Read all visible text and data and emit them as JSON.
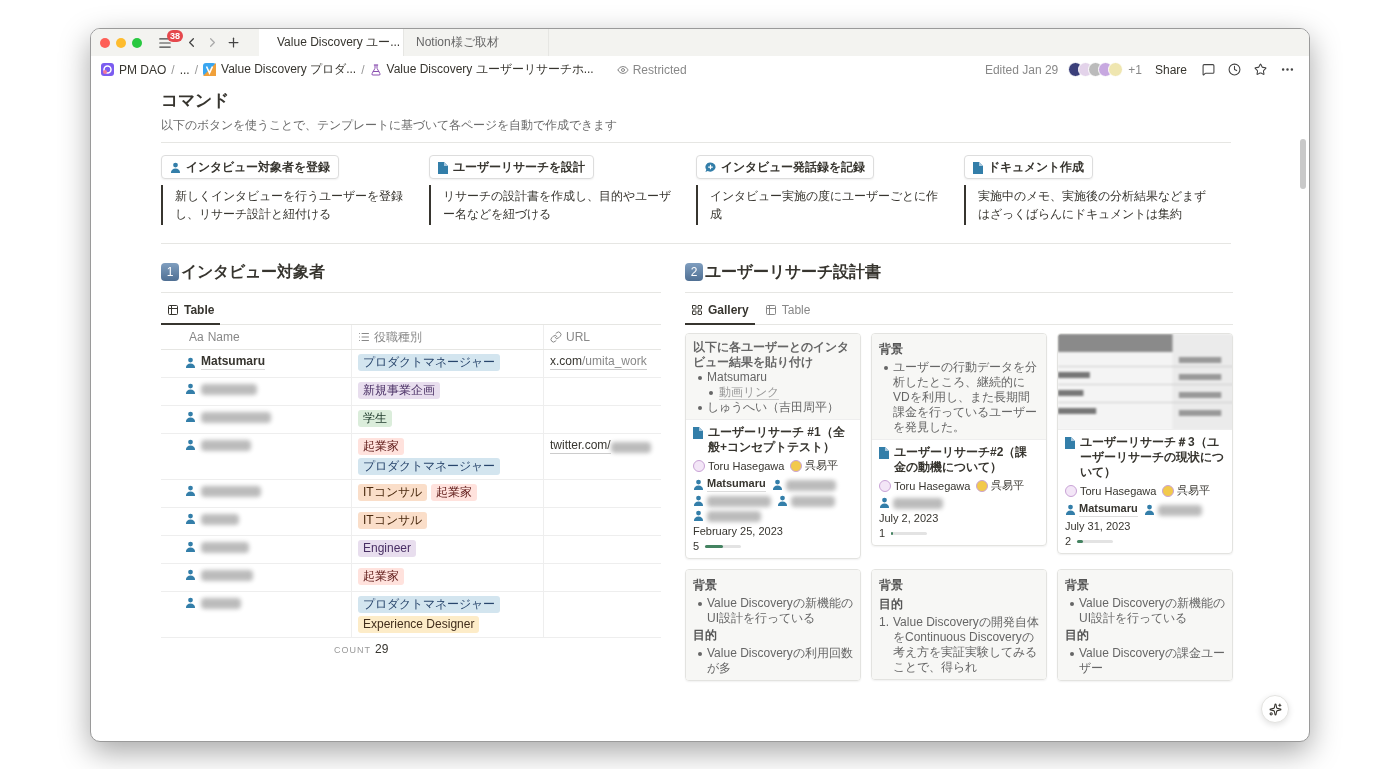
{
  "window": {
    "badge": "38",
    "tabs": [
      {
        "label": "Value Discovery ユー...",
        "selected": true
      },
      {
        "label": "Notion様ご取材",
        "selected": false
      }
    ]
  },
  "breadcrumb": [
    {
      "kind": "page",
      "label": "PM DAO"
    },
    {
      "kind": "separator",
      "label": "/"
    },
    {
      "kind": "page",
      "label": "..."
    },
    {
      "kind": "separator",
      "label": "/"
    },
    {
      "kind": "page",
      "label": "Value Discovery プロダ..."
    },
    {
      "kind": "separator",
      "label": "/"
    },
    {
      "kind": "page",
      "label": "Value Discovery ユーザーリサーチホ..."
    }
  ],
  "access": "Restricted",
  "edited": "Edited Jan 29",
  "more_avatars": "+1",
  "share": "Share",
  "commands": {
    "title": "コマンド",
    "subtitle": "以下のボタンを使うことで、テンプレートに基づいて各ページを自動で作成できます",
    "items": [
      {
        "label": "インタビュー対象者を登録",
        "description": "新しくインタビューを行うユーザーを登録し、リサーチ設計と紐付ける"
      },
      {
        "label": "ユーザーリサーチを設計",
        "description": "リサーチの設計書を作成し、目的やユーザー名などを紐づける"
      },
      {
        "label": "インタビュー発話録を記録",
        "description": "インタビュー実施の度にユーザーごとに作成"
      },
      {
        "label": "ドキュメント作成",
        "description": "実施中のメモ、実施後の分析結果などまずはざっくばらんにドキュメントは集約"
      }
    ]
  },
  "interviewees": {
    "number": "1",
    "title": "インタビュー対象者",
    "views": [
      {
        "label": "Table",
        "selected": true
      }
    ],
    "columns": [
      {
        "label": "Name",
        "prefix": "Aa"
      },
      {
        "label": "役職種別"
      },
      {
        "label": "URL"
      }
    ],
    "rows": [
      {
        "name": "Matsumaru",
        "tags": [
          {
            "label": "プロダクトマネージャー",
            "color": "#d3e5ef"
          }
        ],
        "url": {
          "host": "x.com",
          "path": "/umita_work"
        }
      },
      {
        "redacted": true,
        "tags": [
          {
            "label": "新規事業企画",
            "color": "#e8deee"
          }
        ]
      },
      {
        "redacted": true,
        "tags": [
          {
            "label": "学生",
            "color": "#dbeddb"
          }
        ]
      },
      {
        "redacted": true,
        "tags": [
          {
            "label": "起業家",
            "color": "#ffe2dd"
          },
          {
            "label": "プロダクトマネージャー",
            "color": "#d3e5ef"
          }
        ],
        "url": {
          "host": "twitter.com/",
          "redacted": true
        }
      },
      {
        "redacted": true,
        "tags": [
          {
            "label": "ITコンサル",
            "color": "#fadec9"
          },
          {
            "label": "起業家",
            "color": "#ffe2dd"
          }
        ]
      },
      {
        "redacted": true,
        "tags": [
          {
            "label": "ITコンサル",
            "color": "#fadec9"
          }
        ]
      },
      {
        "redacted": true,
        "tags": [
          {
            "label": "Engineer",
            "color": "#e8deee"
          }
        ]
      },
      {
        "redacted": true,
        "tags": [
          {
            "label": "起業家",
            "color": "#ffe2dd"
          }
        ]
      },
      {
        "redacted": true,
        "tags": [
          {
            "label": "プロダクトマネージャー",
            "color": "#d3e5ef"
          },
          {
            "label": "Experience Designer",
            "color": "#fdecc8"
          }
        ]
      }
    ],
    "count": {
      "label": "COUNT",
      "value": "29"
    }
  },
  "research": {
    "number": "2",
    "title": "ユーザーリサーチ設計書",
    "views": [
      {
        "label": "Gallery",
        "selected": true
      },
      {
        "label": "Table",
        "selected": false
      }
    ],
    "cards": [
      {
        "cover": {
          "kind": "notes",
          "blocks": [
            {
              "kind": "lead",
              "text": "以下に各ユーザーとのインタビュー結果を貼り付け"
            },
            {
              "kind": "bullet",
              "text": "Matsumaru"
            },
            {
              "kind": "subbullet",
              "text": "動画リンク"
            },
            {
              "kind": "bullet",
              "text": "しゅうへい（吉田周平）"
            }
          ]
        },
        "title": "ユーザーリサーチ #1（全般+コンセプトテスト）",
        "owners": [
          "Toru Hasegawa",
          "呉易平"
        ],
        "people": [
          {
            "name": "Matsumaru"
          },
          {
            "redacted": true
          },
          {
            "redacted": true
          },
          {
            "redacted": true
          },
          {
            "redacted": true
          }
        ],
        "date": "February 25, 2023",
        "progress": {
          "value": "5",
          "level": 0.5
        }
      },
      {
        "cover": {
          "kind": "notes",
          "blocks": [
            {
              "kind": "heading",
              "text": "背景"
            },
            {
              "kind": "bullet",
              "text": "ユーザーの行動データを分析したところ、継続的にVDを利用し、また長期間課金を行っているユーザーを発見した。"
            }
          ]
        },
        "title": "ユーザーリサーチ#2（課金の動機について）",
        "owners": [
          "Toru Hasegawa",
          "呉易平"
        ],
        "people": [
          {
            "redacted": true
          }
        ],
        "date": "July 2, 2023",
        "progress": {
          "value": "1",
          "level": 0.05
        }
      },
      {
        "cover": {
          "kind": "picture"
        },
        "title": "ユーザーリサーチ＃3（ユーザーリサーチの現状について）",
        "owners": [
          "Toru Hasegawa",
          "呉易平"
        ],
        "people": [
          {
            "name": "Matsumaru"
          },
          {
            "redacted": true
          }
        ],
        "date": "July 31, 2023",
        "progress": {
          "value": "2",
          "level": 0.15
        }
      },
      {
        "cover": {
          "kind": "notes",
          "blocks": [
            {
              "kind": "heading",
              "text": "背景"
            },
            {
              "kind": "bullet",
              "text": "Value Discoveryの新機能のUI設計を行っている"
            },
            {
              "kind": "heading",
              "text": "目的"
            },
            {
              "kind": "bullet",
              "text": "Value Discoveryの利用回数が多"
            }
          ]
        }
      },
      {
        "cover": {
          "kind": "notes",
          "blocks": [
            {
              "kind": "heading",
              "text": "背景"
            },
            {
              "kind": "heading",
              "text": "目的"
            },
            {
              "kind": "numbered",
              "marker": "1.",
              "text": "Value Discoveryの開発自体をContinuous Discoveryの考え方を実証実験してみることで、得られ"
            }
          ]
        }
      },
      {
        "cover": {
          "kind": "notes",
          "blocks": [
            {
              "kind": "heading",
              "text": "背景"
            },
            {
              "kind": "bullet",
              "text": "Value Discoveryの新機能のUI設計を行っている"
            },
            {
              "kind": "heading",
              "text": "目的"
            },
            {
              "kind": "bullet",
              "text": "Value Discoveryの課金ユーザー"
            }
          ]
        }
      }
    ]
  }
}
